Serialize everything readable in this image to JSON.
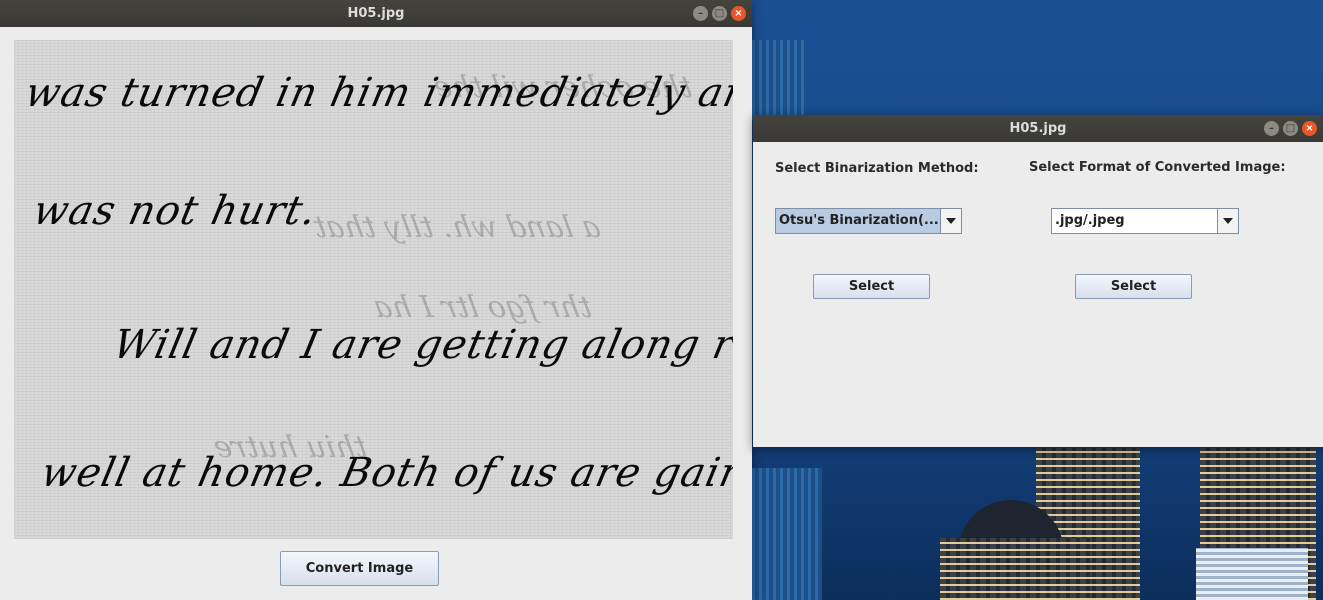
{
  "image_window": {
    "title": "H05.jpg",
    "handwriting_lines": [
      "was turned in him immediately and he",
      "was not hurt.",
      "Will and I are getting along real",
      "well at home. Both of us are gaining"
    ],
    "convert_button": "Convert Image"
  },
  "options_window": {
    "title": "H05.jpg",
    "binarization_label": "Select Binarization Method:",
    "binarization_selected": "Otsu's Binarization(...",
    "format_label": "Select Format of Converted Image:",
    "format_selected": ".jpg/.jpeg",
    "select_button_1": "Select",
    "select_button_2": "Select"
  },
  "icons": [
    "minimize-icon",
    "maximize-icon",
    "close-icon",
    "dropdown-arrow-icon"
  ],
  "colors": {
    "titlebar": "#3a3935",
    "close": "#e8562a",
    "window_bg": "#ececec",
    "combo_selected": "#b9cbe2"
  }
}
